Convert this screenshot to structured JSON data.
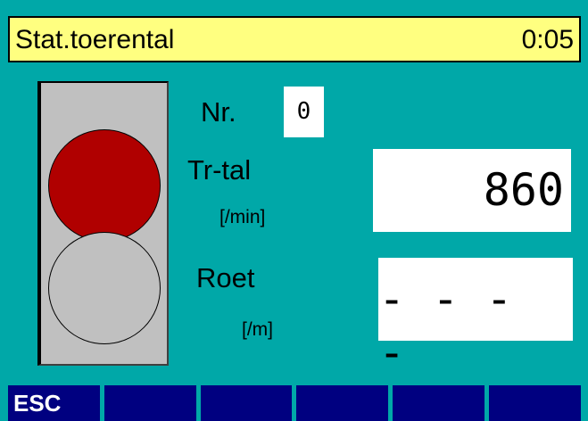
{
  "header": {
    "title": "Stat.toerental",
    "time": "0:05"
  },
  "signal": {
    "top_lamp_color": "#b00000",
    "bottom_lamp_color": "#c0c0c0"
  },
  "fields": {
    "nr": {
      "label": "Nr.",
      "value": "0"
    },
    "rpm": {
      "label": "Tr-tal",
      "unit": "[/min]",
      "value": "860"
    },
    "soot": {
      "label": "Roet",
      "unit": "[/m]",
      "value": "- - - -"
    }
  },
  "softkeys": [
    "ESC",
    "",
    "",
    "",
    "",
    ""
  ],
  "colors": {
    "background": "#00a8a8",
    "title_bar": "#ffff80",
    "softkey": "#000080"
  }
}
